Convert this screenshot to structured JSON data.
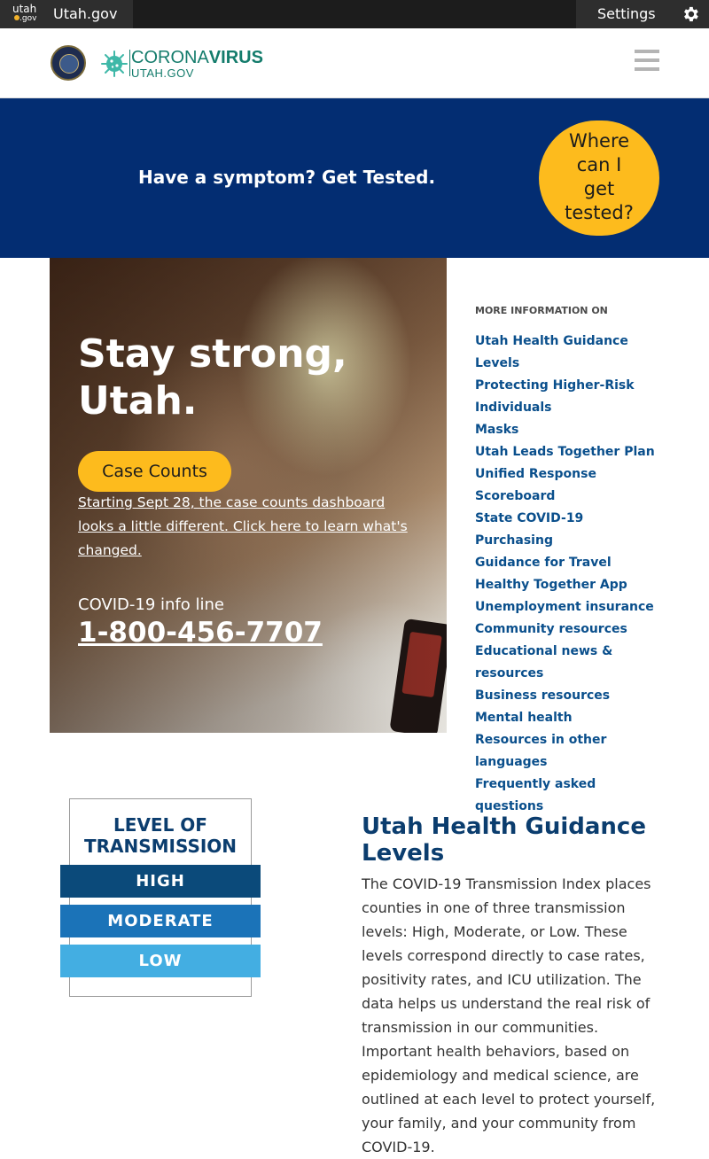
{
  "topbar": {
    "logo_line1": "utah",
    "logo_line2": ".gov",
    "site_link": "Utah.gov",
    "settings_label": "Settings"
  },
  "header": {
    "brand_line1_a": "CORONA",
    "brand_line1_b": "VIRUS",
    "brand_line2": "UTAH.GOV"
  },
  "banner": {
    "message": "Have a symptom? Get Tested.",
    "cta_lines": [
      "Where",
      "can I",
      "get",
      "tested?"
    ]
  },
  "hero": {
    "headline_line1": "Stay strong,",
    "headline_line2": "Utah.",
    "button_label": "Case Counts",
    "note": "Starting Sept 28, the case counts dashboard looks a little different. Click here to learn what's changed.",
    "info_label": "COVID-19 info line",
    "phone": "1-800-456-7707"
  },
  "more_info": {
    "heading": "MORE INFORMATION ON",
    "links": [
      "Utah Health Guidance Levels",
      "Protecting Higher-Risk Individuals",
      "Masks",
      "Utah Leads Together Plan",
      "Unified Response Scoreboard",
      "State COVID-19 Purchasing",
      "Guidance for Travel",
      "Healthy Together App",
      "Unemployment insurance",
      "Community resources",
      "Educational news & resources",
      "Business resources",
      "Mental health",
      "Resources in other languages",
      "Frequently asked questions"
    ]
  },
  "levels_graphic": {
    "title_line1": "LEVEL OF",
    "title_line2": "TRANSMISSION",
    "high": "HIGH",
    "moderate": "MODERATE",
    "low": "LOW"
  },
  "guidance": {
    "title": "Utah Health Guidance Levels",
    "body": "The COVID-19 Transmission Index places counties in one of three transmission levels: High, Moderate, or Low. These levels correspond directly to case rates, positivity rates, and ICU utilization. The data helps us understand the real risk of transmission in our communities. Important health behaviors, based on epidemiology and medical science, are outlined at each level to protect yourself, your family, and your community from COVID-19."
  },
  "colors": {
    "banner": "#032d72",
    "accent_yellow": "#fdbb1d",
    "link_blue": "#0a4f8c",
    "brand_teal": "#147c6c"
  }
}
